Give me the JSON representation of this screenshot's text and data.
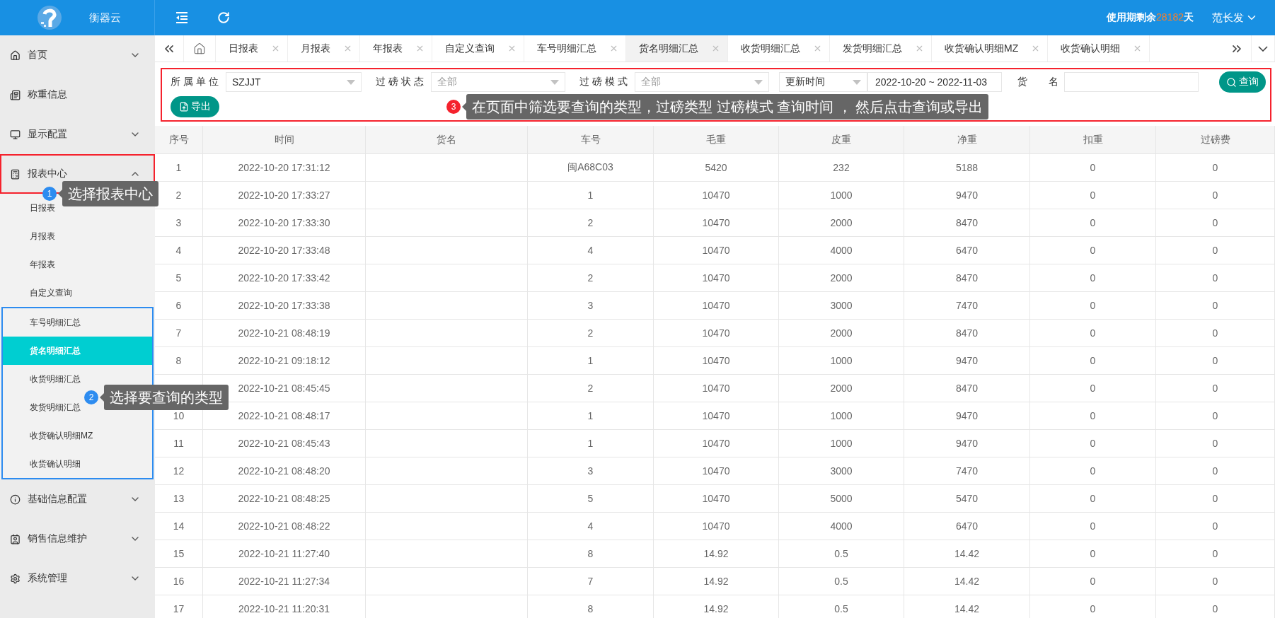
{
  "header": {
    "app_name": "衡器云",
    "remaining_label": "使用期剩余",
    "remaining_days": "28182",
    "remaining_unit": "天",
    "user": "范长发"
  },
  "sidebar": {
    "items": [
      {
        "label": "首页",
        "kind": "menu",
        "expanded": false
      },
      {
        "label": "称重信息",
        "kind": "link"
      },
      {
        "label": "显示配置",
        "kind": "menu",
        "expanded": false
      },
      {
        "label": "报表中心",
        "kind": "menu",
        "expanded": true,
        "children": [
          {
            "label": "日报表",
            "selected": false
          },
          {
            "label": "月报表",
            "selected": false
          },
          {
            "label": "年报表",
            "selected": false
          },
          {
            "label": "自定义查询",
            "selected": false
          },
          {
            "label": "车号明细汇总",
            "selected": false
          },
          {
            "label": "货名明细汇总",
            "selected": true
          },
          {
            "label": "收货明细汇总",
            "selected": false
          },
          {
            "label": "发货明细汇总",
            "selected": false
          },
          {
            "label": "收货确认明细MZ",
            "selected": false
          },
          {
            "label": "收货确认明细",
            "selected": false
          }
        ]
      },
      {
        "label": "基础信息配置",
        "kind": "menu",
        "expanded": false
      },
      {
        "label": "销售信息维护",
        "kind": "menu",
        "expanded": false
      },
      {
        "label": "系统管理",
        "kind": "menu",
        "expanded": false
      }
    ]
  },
  "tabs": [
    {
      "label": "日报表",
      "selected": false
    },
    {
      "label": "月报表",
      "selected": false
    },
    {
      "label": "年报表",
      "selected": false
    },
    {
      "label": "自定义查询",
      "selected": false
    },
    {
      "label": "车号明细汇总",
      "selected": false
    },
    {
      "label": "货名明细汇总",
      "selected": true
    },
    {
      "label": "收货明细汇总",
      "selected": false
    },
    {
      "label": "发货明细汇总",
      "selected": false
    },
    {
      "label": "收货确认明细MZ",
      "selected": false
    },
    {
      "label": "收货确认明细",
      "selected": false
    }
  ],
  "filters": {
    "unit": {
      "label": "所属单位",
      "value": "SZJJT"
    },
    "status": {
      "label": "过磅状态",
      "placeholder": "全部"
    },
    "mode": {
      "label": "过磅模式",
      "placeholder": "全部"
    },
    "time_type": {
      "value": "更新时间"
    },
    "date_range": {
      "value": "2022-10-20 ~ 2022-11-03"
    },
    "goods": {
      "label": "货名"
    },
    "query_button": "查询",
    "export_button": "导出"
  },
  "table": {
    "columns": [
      "序号",
      "时间",
      "货名",
      "车号",
      "毛重",
      "皮重",
      "净重",
      "扣重",
      "过磅费"
    ],
    "rows": [
      [
        "1",
        "2022-10-20 17:31:12",
        "",
        "闽A68C03",
        "5420",
        "232",
        "5188",
        "0",
        "0"
      ],
      [
        "2",
        "2022-10-20 17:33:27",
        "",
        "1",
        "10470",
        "1000",
        "9470",
        "0",
        "0"
      ],
      [
        "3",
        "2022-10-20 17:33:30",
        "",
        "2",
        "10470",
        "2000",
        "8470",
        "0",
        "0"
      ],
      [
        "4",
        "2022-10-20 17:33:48",
        "",
        "4",
        "10470",
        "4000",
        "6470",
        "0",
        "0"
      ],
      [
        "5",
        "2022-10-20 17:33:42",
        "",
        "2",
        "10470",
        "2000",
        "8470",
        "0",
        "0"
      ],
      [
        "6",
        "2022-10-20 17:33:38",
        "",
        "3",
        "10470",
        "3000",
        "7470",
        "0",
        "0"
      ],
      [
        "7",
        "2022-10-21 08:48:19",
        "",
        "2",
        "10470",
        "2000",
        "8470",
        "0",
        "0"
      ],
      [
        "8",
        "2022-10-21 09:18:12",
        "",
        "1",
        "10470",
        "1000",
        "9470",
        "0",
        "0"
      ],
      [
        "",
        "2022-10-21 08:45:45",
        "",
        "2",
        "10470",
        "2000",
        "8470",
        "0",
        "0"
      ],
      [
        "10",
        "2022-10-21 08:48:17",
        "",
        "1",
        "10470",
        "1000",
        "9470",
        "0",
        "0"
      ],
      [
        "11",
        "2022-10-21 08:45:43",
        "",
        "1",
        "10470",
        "1000",
        "9470",
        "0",
        "0"
      ],
      [
        "12",
        "2022-10-21 08:48:20",
        "",
        "3",
        "10470",
        "3000",
        "7470",
        "0",
        "0"
      ],
      [
        "13",
        "2022-10-21 08:48:25",
        "",
        "5",
        "10470",
        "5000",
        "5470",
        "0",
        "0"
      ],
      [
        "14",
        "2022-10-21 08:48:22",
        "",
        "4",
        "10470",
        "4000",
        "6470",
        "0",
        "0"
      ],
      [
        "15",
        "2022-10-21 11:27:40",
        "",
        "8",
        "14.92",
        "0.5",
        "14.42",
        "0",
        "0"
      ],
      [
        "16",
        "2022-10-21 11:27:34",
        "",
        "7",
        "14.92",
        "0.5",
        "14.42",
        "0",
        "0"
      ],
      [
        "17",
        "2022-10-21 11:20:31",
        "",
        "8",
        "14.92",
        "0.5",
        "14.42",
        "0",
        "0"
      ]
    ]
  },
  "annotations": [
    {
      "number": "1",
      "text": "选择报表中心",
      "color": "#2d8cf0"
    },
    {
      "number": "2",
      "text": "选择要查询的类型",
      "color": "#2d8cf0"
    },
    {
      "number": "3",
      "text": "在页面中筛选要查询的类型，过磅类型 过磅模式 查询时间 ， 然后点击查询或导出",
      "color": "#f5222d"
    }
  ]
}
